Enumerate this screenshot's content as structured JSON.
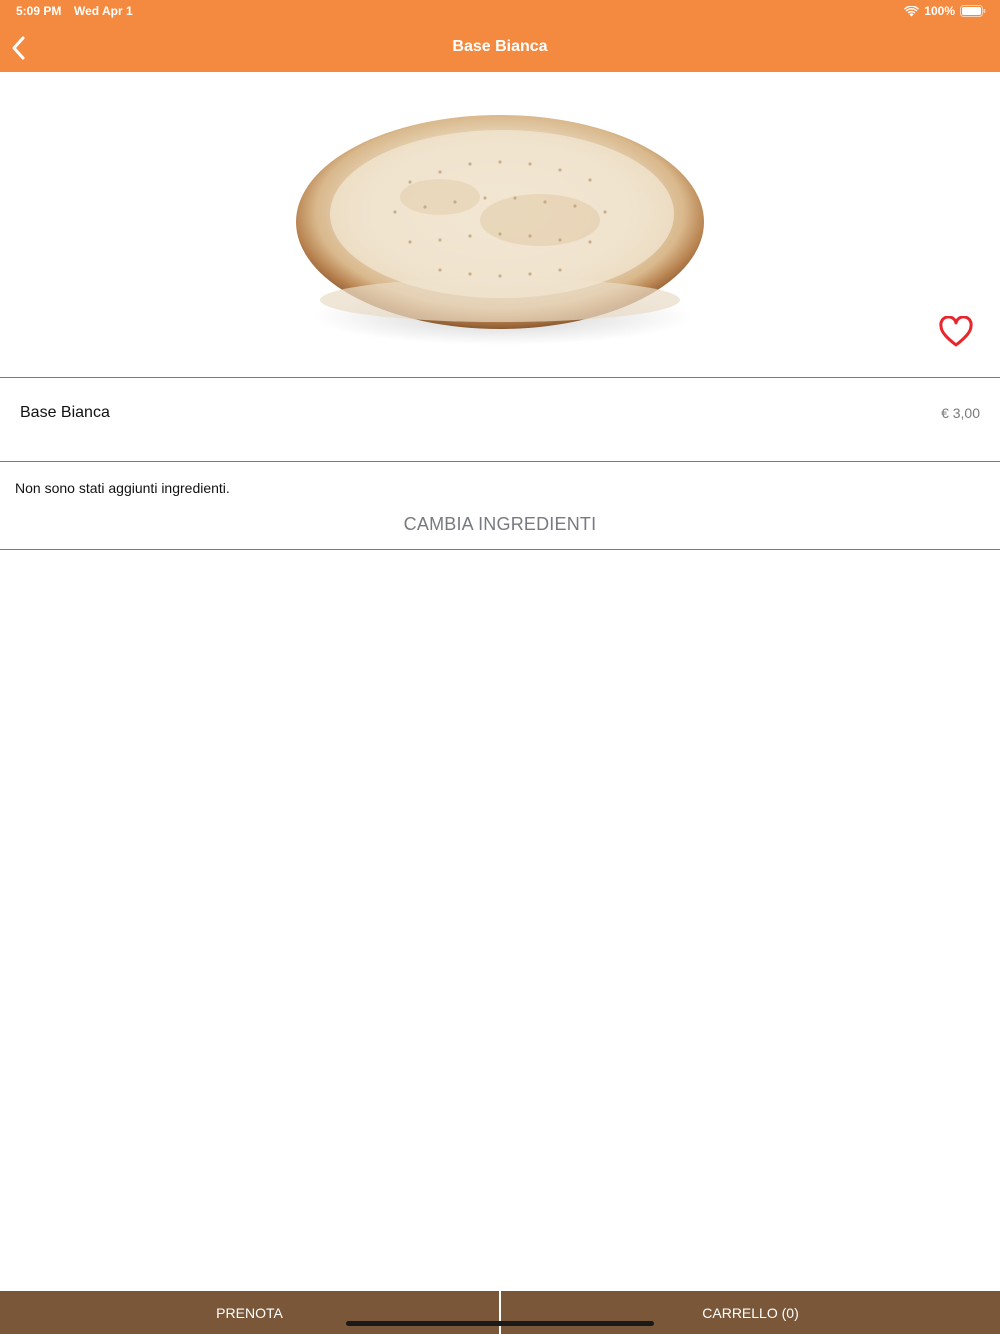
{
  "status_bar": {
    "time": "5:09 PM",
    "date": "Wed Apr 1",
    "battery": "100%",
    "icons": [
      "wifi-icon",
      "battery-icon"
    ]
  },
  "nav": {
    "title": "Base Bianca",
    "back_icon": "chevron-left-icon"
  },
  "product": {
    "image": "pizza-base-image",
    "favorite_icon": "heart-outline-icon",
    "name": "Base Bianca",
    "price": "€ 3,00"
  },
  "ingredients": {
    "message": "Non sono stati aggiunti ingredienti.",
    "change_label": "CAMBIA INGREDIENTI"
  },
  "bottom_bar": {
    "reserve_label": "PRENOTA",
    "cart_label": "CARRELLO (0)"
  },
  "colors": {
    "header": "#f38a3f",
    "bottom_bar": "#7b5739",
    "heart": "#e8262b",
    "price_text": "#7a7a7a",
    "change_button_text": "#777a80"
  }
}
